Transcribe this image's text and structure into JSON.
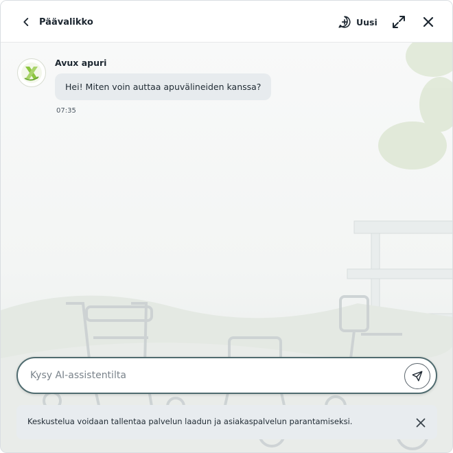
{
  "header": {
    "back_label": "Päävalikko",
    "new_label": "Uusi"
  },
  "messages": [
    {
      "sender": "Avux apuri",
      "text": "Hei! Miten voin auttaa apuvälineiden kanssa?",
      "time": "07:35"
    }
  ],
  "composer": {
    "placeholder": "Kysy AI-assistentilta",
    "value": ""
  },
  "notice": {
    "text": "Keskustelua voidaan tallentaa palvelun laadun ja asiakaspalvelun parantamiseksi."
  },
  "colors": {
    "logo_green": "#8cc63f",
    "composer_border": "#4f6b6f",
    "bubble_bg": "#e7ebee"
  },
  "icons": {
    "back": "chevron-left-icon",
    "new": "chat-plus-icon",
    "expand": "expand-arrows-icon",
    "close": "close-icon",
    "send": "send-paper-plane-icon"
  }
}
